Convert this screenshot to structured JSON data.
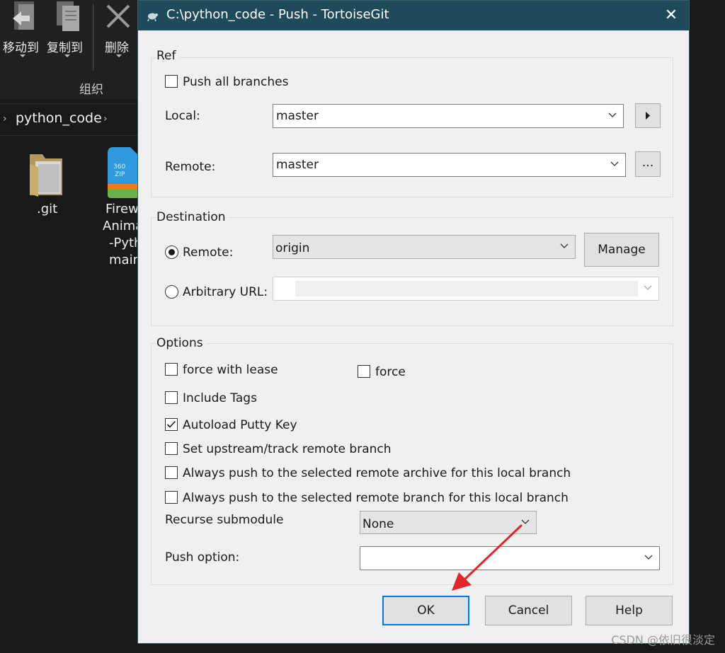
{
  "explorer": {
    "ribbon": {
      "move_to": "移动到",
      "copy_to": "复制到",
      "delete": "删除",
      "group_label": "组织"
    },
    "address": {
      "folder": "python_code"
    },
    "files": [
      {
        "name": ".git"
      },
      {
        "name_lines": [
          "Firew",
          "Anima",
          "-Pyth",
          "main"
        ]
      }
    ]
  },
  "dialog": {
    "title": "C:\\python_code - Push - TortoiseGit",
    "ref": {
      "group_label": "Ref",
      "push_all_branches": {
        "label": "Push all branches",
        "checked": false
      },
      "local_label": "Local:",
      "local_value": "master",
      "remote_label": "Remote:",
      "remote_value": "master",
      "browse_button": "..."
    },
    "destination": {
      "group_label": "Destination",
      "remote_radio": {
        "label": "Remote:",
        "selected": true
      },
      "remote_value": "origin",
      "manage_button": "Manage",
      "url_radio": {
        "label": "Arbitrary URL:",
        "selected": false
      },
      "url_value": ""
    },
    "options": {
      "group_label": "Options",
      "force_with_lease": {
        "label": "force with lease",
        "checked": false
      },
      "force": {
        "label": "force",
        "checked": false
      },
      "include_tags": {
        "label": "Include Tags",
        "checked": false
      },
      "autoload_putty": {
        "label": "Autoload Putty Key",
        "checked": true
      },
      "set_upstream": {
        "label": "Set upstream/track remote branch",
        "checked": false
      },
      "always_push_archive": {
        "label": "Always push to the selected remote archive for this local branch",
        "checked": false
      },
      "always_push_branch": {
        "label": "Always push to the selected remote branch for this local branch",
        "checked": false
      },
      "recurse_label": "Recurse submodule",
      "recurse_value": "None",
      "push_option_label": "Push option:",
      "push_option_value": ""
    },
    "buttons": {
      "ok": "OK",
      "cancel": "Cancel",
      "help": "Help"
    }
  },
  "watermark": "CSDN @依旧很淡定",
  "colors": {
    "titlebar": "#1f4a59",
    "dialog_bg": "#f0f0f0",
    "accent": "#0078d7",
    "annotation_arrow": "#e0262b"
  }
}
